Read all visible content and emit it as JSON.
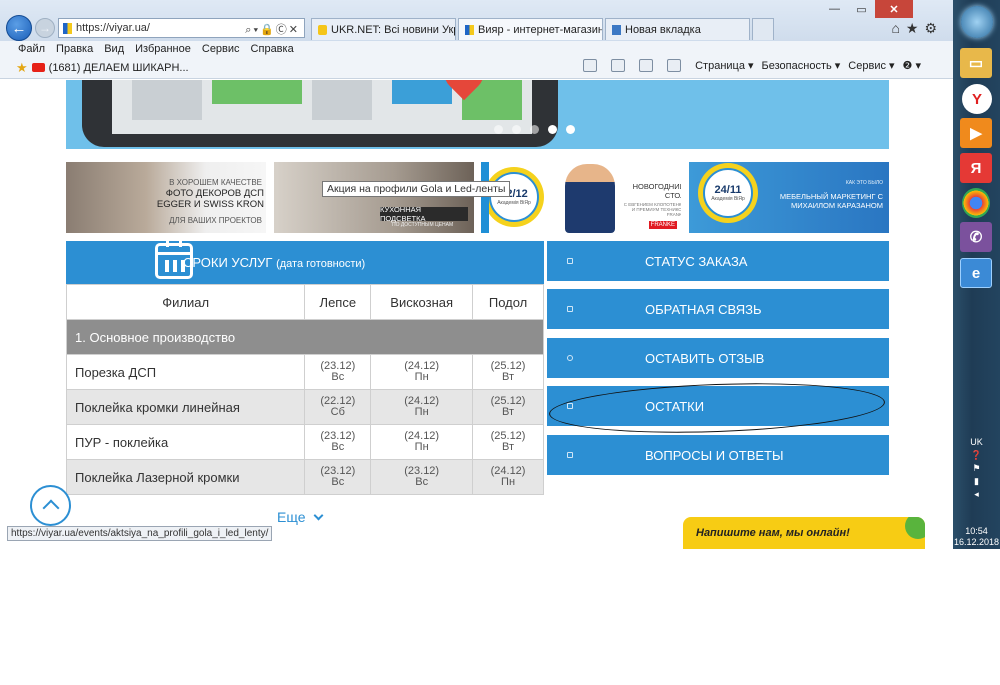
{
  "browser": {
    "url": "https://viyar.ua/",
    "tabs": [
      {
        "title": "UKR.NET: Всі новини України,...",
        "active": false
      },
      {
        "title": "Вияр - интернет-магазин ...",
        "active": true
      },
      {
        "title": "Новая вкладка",
        "active": false
      }
    ],
    "menu": [
      "Файл",
      "Правка",
      "Вид",
      "Избранное",
      "Сервис",
      "Справка"
    ],
    "favorite": "(1681) ДЕЛАЕМ ШИКАРН...",
    "commands": [
      "Страница ▾",
      "Безопасность ▾",
      "Сервис ▾",
      "❷ ▾"
    ],
    "status_url": "https://viyar.ua/events/aktsiya_na_profili_gola_i_led_lenty/",
    "tooltip": "Акция на профили Gola и Led-ленты"
  },
  "banners": {
    "b1_small": "В ХОРОШЕМ КАЧЕСТВЕ",
    "b1_title": "ФОТО ДЕКОРОВ ДСП\nEGGER И SWISS KRON",
    "b1_sub": "ДЛЯ ВАШИХ ПРОЕКТОВ",
    "b2_caption": "КУХОННАЯ ПОДСВЕТКА",
    "b2_sub": "ПО ДОСТУПНЫМ ЦЕНАМ",
    "b3_date": "22/12",
    "b3_badge_sub": "Академія ВіЯр",
    "b3_title": "НОВОГОДНИЙ\nСТОЛ",
    "b3_sub": "С ЕВГЕНИЕМ КЛОПОТЕНКО И ПРЕМИУМ ТЕХНИКОЙ FRANKE",
    "b3_brand": "FRANKE",
    "b4_date": "24/11",
    "b4_badge_sub": "Академія ВіЯр",
    "b4_small": "КАК ЭТО БЫЛО",
    "b4_title": "МЕБЕЛЬНЫЙ МАРКЕТИНГ С\nМИХАИЛОМ КАРАЗАНОМ"
  },
  "schedule": {
    "title": "СРОКИ УСЛУГ",
    "subtitle": "(дата готовности)",
    "headers": [
      "Филиал",
      "Лепсе",
      "Вискозная",
      "Подол"
    ],
    "group": "1. Основное производство",
    "rows": [
      {
        "service": "Порезка ДСП",
        "cells": [
          [
            "(23.12)",
            "Вс"
          ],
          [
            "(24.12)",
            "Пн"
          ],
          [
            "(25.12)",
            "Вт"
          ]
        ]
      },
      {
        "service": "Поклейка кромки линейная",
        "cells": [
          [
            "(22.12)",
            "Сб"
          ],
          [
            "(24.12)",
            "Пн"
          ],
          [
            "(25.12)",
            "Вт"
          ]
        ]
      },
      {
        "service": "ПУР - поклейка",
        "cells": [
          [
            "(23.12)",
            "Вс"
          ],
          [
            "(24.12)",
            "Пн"
          ],
          [
            "(25.12)",
            "Вт"
          ]
        ]
      },
      {
        "service": "Поклейка Лазерной кромки",
        "cells": [
          [
            "(23.12)",
            "Вс"
          ],
          [
            "(23.12)",
            "Вс"
          ],
          [
            "(24.12)",
            "Пн"
          ]
        ]
      }
    ],
    "more": "Еще"
  },
  "side_buttons": [
    "СТАТУС ЗАКАЗА",
    "ОБРАТНАЯ СВЯЗЬ",
    "ОСТАВИТЬ ОТЗЫВ",
    "ОСТАТКИ",
    "ВОПРОСЫ И ОТВЕТЫ"
  ],
  "chat": "Напишите нам, мы онлайн!",
  "taskbar": {
    "lang": "UK",
    "time": "10:54",
    "date": "16.12.2018"
  },
  "colors": {
    "accent": "#2c8fd3",
    "group_row": "#8e8e8e",
    "chat": "#f7cc14"
  }
}
